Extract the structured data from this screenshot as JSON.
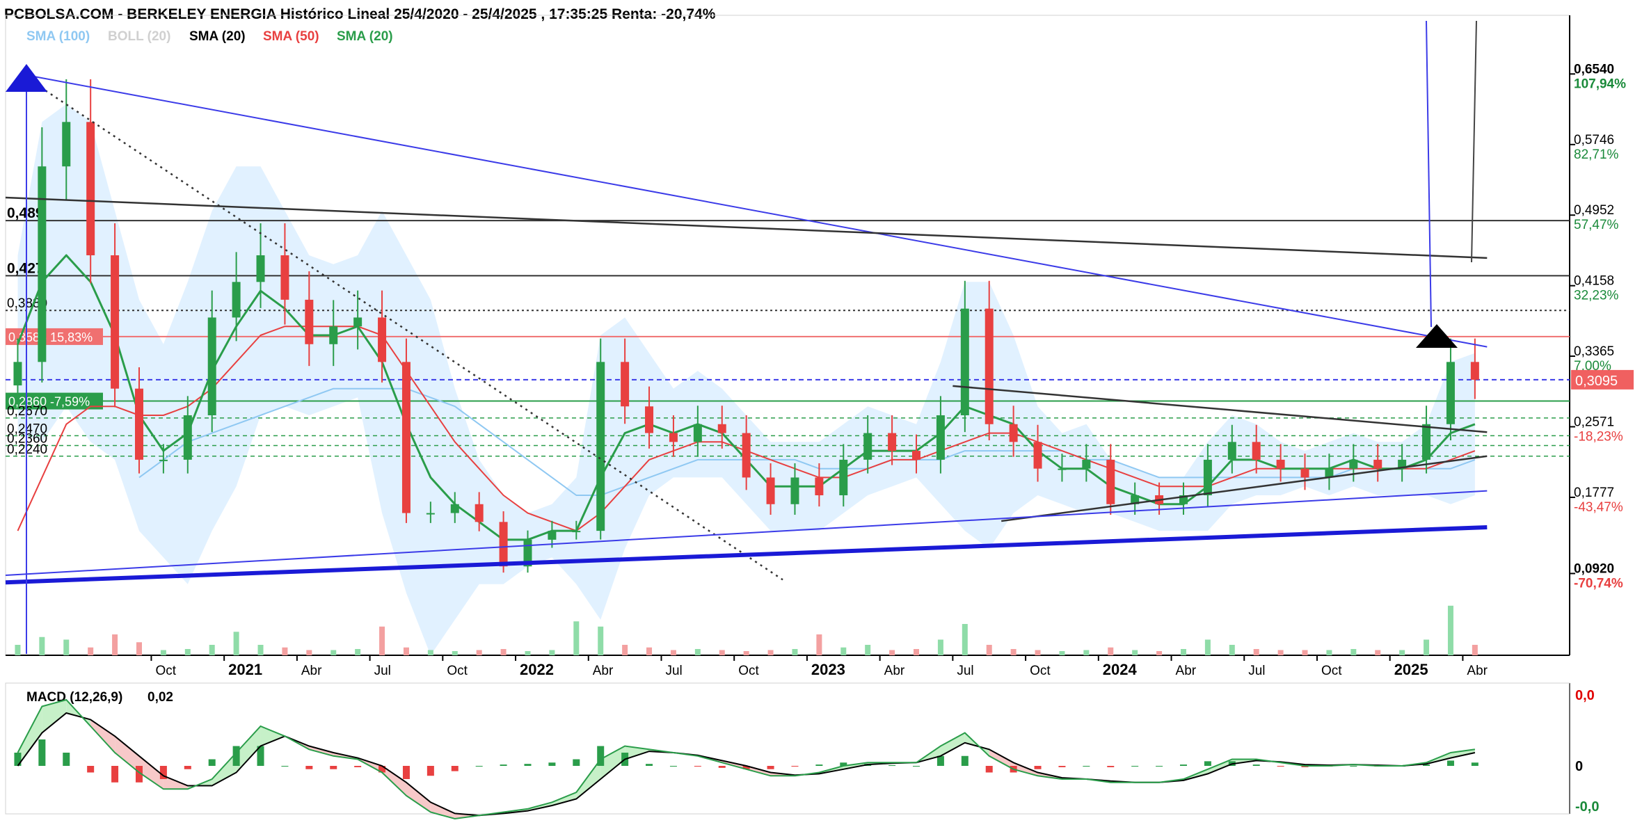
{
  "header": {
    "title": "PCBOLSA.COM - BERKELEY ENERGIA Histórico Lineal 25/4/2020 - 25/4/2025 , 17:35:25 Renta: -20,74%"
  },
  "legend": [
    {
      "label": "SMA (100)",
      "color": "#8fc8f2"
    },
    {
      "label": "BOLL (20)",
      "color": "#d0d0d0"
    },
    {
      "label": "SMA (20)",
      "color": "#000000"
    },
    {
      "label": "SMA (50)",
      "color": "#e84040"
    },
    {
      "label": "SMA (20)",
      "color": "#2a9d4a"
    }
  ],
  "colors": {
    "up": "#2a9d4a",
    "down": "#e84040",
    "trend_blue": "#3b3be8",
    "trend_black": "#333333",
    "boll_fill": "#dcefff",
    "sma100": "#8fc8f2"
  },
  "chart_data": {
    "type": "candlestick",
    "title": "PCBOLSA.COM - BERKELEY ENERGIA Histórico Lineal 25/4/2020 - 25/4/2025 , 17:35:25 Renta: -20,74%",
    "x_axis": {
      "ticks": [
        "Oct",
        "2021",
        "Abr",
        "Jul",
        "Oct",
        "2022",
        "Abr",
        "Jul",
        "Oct",
        "2023",
        "Abr",
        "Jul",
        "Oct",
        "2024",
        "Abr",
        "Jul",
        "Oct",
        "2025",
        "Abr"
      ],
      "bold_ticks": [
        "2021",
        "2022",
        "2023",
        "2024",
        "2025"
      ]
    },
    "y_axis": {
      "ticks": [
        {
          "price": "0,6540",
          "pct": "107,94%",
          "pct_color": "#1a8a3a"
        },
        {
          "price": "0,5746",
          "pct": "82,71%",
          "pct_color": "#1a8a3a"
        },
        {
          "price": "0,4952",
          "pct": "57,47%",
          "pct_color": "#1a8a3a"
        },
        {
          "price": "0,4158",
          "pct": "32,23%",
          "pct_color": "#1a8a3a"
        },
        {
          "price": "0,3365",
          "pct": "7,00%",
          "pct_color": "#1a8a3a"
        },
        {
          "price": "0,2571",
          "pct": "-18,23%",
          "pct_color": "#e84040"
        },
        {
          "price": "0,1777",
          "pct": "-43,47%",
          "pct_color": "#e84040"
        },
        {
          "price": "0,0920",
          "pct": "-70,74%",
          "pct_color": "#e84040"
        }
      ],
      "last_price": "0,3095",
      "range": [
        0.0,
        0.72
      ]
    },
    "levels": [
      {
        "value": 0.489,
        "label": "0,489"
      },
      {
        "value": 0.427,
        "label": "0,427"
      },
      {
        "value": 0.388,
        "label": "0,3880"
      },
      {
        "value": 0.3585,
        "label": "0,3585 15,83%"
      },
      {
        "value": 0.286,
        "label": "0,2860 -7,59%"
      },
      {
        "value": 0.267,
        "label": "0,2670"
      },
      {
        "value": 0.247,
        "label": "0,2470"
      },
      {
        "value": 0.236,
        "label": "0,2360"
      },
      {
        "value": 0.224,
        "label": "0,2240"
      }
    ],
    "price_series": [
      {
        "date": "2020-04",
        "value": 0.33
      },
      {
        "date": "2020-05",
        "value": 0.55
      },
      {
        "date": "2020-06",
        "value": 0.6
      },
      {
        "date": "2020-07",
        "value": 0.45
      },
      {
        "date": "2020-08",
        "value": 0.3
      },
      {
        "date": "2020-09",
        "value": 0.22
      },
      {
        "date": "2020-10",
        "value": 0.22
      },
      {
        "date": "2020-11",
        "value": 0.27
      },
      {
        "date": "2020-12",
        "value": 0.38
      },
      {
        "date": "2021-01",
        "value": 0.42
      },
      {
        "date": "2021-02",
        "value": 0.45
      },
      {
        "date": "2021-03",
        "value": 0.4
      },
      {
        "date": "2021-04",
        "value": 0.35
      },
      {
        "date": "2021-05",
        "value": 0.37
      },
      {
        "date": "2021-06",
        "value": 0.38
      },
      {
        "date": "2021-07",
        "value": 0.33
      },
      {
        "date": "2021-08",
        "value": 0.16
      },
      {
        "date": "2021-09",
        "value": 0.16
      },
      {
        "date": "2021-10",
        "value": 0.17
      },
      {
        "date": "2021-11",
        "value": 0.15
      },
      {
        "date": "2021-12",
        "value": 0.1
      },
      {
        "date": "2022-01",
        "value": 0.13
      },
      {
        "date": "2022-02",
        "value": 0.14
      },
      {
        "date": "2022-03",
        "value": 0.14
      },
      {
        "date": "2022-04",
        "value": 0.33
      },
      {
        "date": "2022-05",
        "value": 0.28
      },
      {
        "date": "2022-06",
        "value": 0.25
      },
      {
        "date": "2022-07",
        "value": 0.24
      },
      {
        "date": "2022-08",
        "value": 0.26
      },
      {
        "date": "2022-09",
        "value": 0.25
      },
      {
        "date": "2022-10",
        "value": 0.2
      },
      {
        "date": "2022-11",
        "value": 0.17
      },
      {
        "date": "2022-12",
        "value": 0.2
      },
      {
        "date": "2023-01",
        "value": 0.18
      },
      {
        "date": "2023-02",
        "value": 0.22
      },
      {
        "date": "2023-03",
        "value": 0.25
      },
      {
        "date": "2023-04",
        "value": 0.23
      },
      {
        "date": "2023-05",
        "value": 0.22
      },
      {
        "date": "2023-06",
        "value": 0.27
      },
      {
        "date": "2023-07",
        "value": 0.39
      },
      {
        "date": "2023-08",
        "value": 0.26
      },
      {
        "date": "2023-09",
        "value": 0.24
      },
      {
        "date": "2023-10",
        "value": 0.21
      },
      {
        "date": "2023-11",
        "value": 0.21
      },
      {
        "date": "2023-12",
        "value": 0.22
      },
      {
        "date": "2024-01",
        "value": 0.17
      },
      {
        "date": "2024-02",
        "value": 0.18
      },
      {
        "date": "2024-03",
        "value": 0.17
      },
      {
        "date": "2024-04",
        "value": 0.18
      },
      {
        "date": "2024-05",
        "value": 0.22
      },
      {
        "date": "2024-06",
        "value": 0.24
      },
      {
        "date": "2024-07",
        "value": 0.22
      },
      {
        "date": "2024-08",
        "value": 0.21
      },
      {
        "date": "2024-09",
        "value": 0.2
      },
      {
        "date": "2024-10",
        "value": 0.21
      },
      {
        "date": "2024-11",
        "value": 0.22
      },
      {
        "date": "2024-12",
        "value": 0.21
      },
      {
        "date": "2025-01",
        "value": 0.22
      },
      {
        "date": "2025-02",
        "value": 0.26
      },
      {
        "date": "2025-03",
        "value": 0.33
      },
      {
        "date": "2025-04",
        "value": 0.31
      }
    ],
    "sma20": [
      0.35,
      0.42,
      0.45,
      0.42,
      0.36,
      0.27,
      0.23,
      0.25,
      0.32,
      0.37,
      0.41,
      0.39,
      0.36,
      0.36,
      0.37,
      0.33,
      0.26,
      0.2,
      0.17,
      0.15,
      0.13,
      0.13,
      0.14,
      0.14,
      0.2,
      0.25,
      0.26,
      0.25,
      0.26,
      0.25,
      0.22,
      0.19,
      0.19,
      0.19,
      0.21,
      0.23,
      0.23,
      0.23,
      0.25,
      0.28,
      0.27,
      0.26,
      0.23,
      0.21,
      0.21,
      0.19,
      0.18,
      0.17,
      0.17,
      0.19,
      0.22,
      0.22,
      0.21,
      0.21,
      0.21,
      0.22,
      0.21,
      0.21,
      0.22,
      0.25,
      0.26
    ],
    "sma50": [
      0.14,
      0.2,
      0.26,
      0.28,
      0.28,
      0.27,
      0.27,
      0.28,
      0.3,
      0.33,
      0.36,
      0.37,
      0.37,
      0.37,
      0.37,
      0.36,
      0.32,
      0.28,
      0.24,
      0.21,
      0.18,
      0.16,
      0.15,
      0.14,
      0.16,
      0.19,
      0.22,
      0.23,
      0.24,
      0.24,
      0.23,
      0.22,
      0.21,
      0.2,
      0.2,
      0.21,
      0.22,
      0.22,
      0.23,
      0.24,
      0.25,
      0.25,
      0.24,
      0.23,
      0.22,
      0.21,
      0.2,
      0.19,
      0.19,
      0.19,
      0.2,
      0.21,
      0.21,
      0.21,
      0.21,
      0.21,
      0.21,
      0.21,
      0.21,
      0.22,
      0.23
    ],
    "sma100": [
      null,
      null,
      null,
      null,
      null,
      0.2,
      0.22,
      0.24,
      0.25,
      0.26,
      0.27,
      0.28,
      0.29,
      0.3,
      0.3,
      0.3,
      0.3,
      0.29,
      0.28,
      0.26,
      0.24,
      0.22,
      0.2,
      0.18,
      0.18,
      0.19,
      0.2,
      0.21,
      0.22,
      0.22,
      0.22,
      0.22,
      0.22,
      0.21,
      0.21,
      0.21,
      0.22,
      0.22,
      0.22,
      0.23,
      0.23,
      0.23,
      0.23,
      0.23,
      0.22,
      0.22,
      0.21,
      0.2,
      0.2,
      0.2,
      0.2,
      0.2,
      0.2,
      0.2,
      0.2,
      0.21,
      0.21,
      0.21,
      0.21,
      0.21,
      0.22
    ],
    "boll_upper": [
      0.45,
      0.6,
      0.62,
      0.6,
      0.5,
      0.4,
      0.35,
      0.42,
      0.5,
      0.55,
      0.55,
      0.5,
      0.45,
      0.44,
      0.45,
      0.5,
      0.45,
      0.4,
      0.3,
      0.22,
      0.18,
      0.16,
      0.17,
      0.2,
      0.36,
      0.38,
      0.34,
      0.3,
      0.32,
      0.3,
      0.27,
      0.24,
      0.24,
      0.24,
      0.26,
      0.28,
      0.27,
      0.26,
      0.33,
      0.42,
      0.42,
      0.36,
      0.28,
      0.25,
      0.26,
      0.22,
      0.21,
      0.2,
      0.2,
      0.24,
      0.27,
      0.26,
      0.24,
      0.23,
      0.24,
      0.25,
      0.24,
      0.24,
      0.26,
      0.33,
      0.34
    ],
    "boll_lower": [
      0.25,
      0.24,
      0.28,
      0.24,
      0.22,
      0.14,
      0.11,
      0.08,
      0.14,
      0.19,
      0.27,
      0.28,
      0.27,
      0.28,
      0.29,
      0.16,
      0.07,
      0.0,
      0.04,
      0.08,
      0.08,
      0.1,
      0.11,
      0.08,
      0.04,
      0.12,
      0.18,
      0.2,
      0.2,
      0.2,
      0.17,
      0.14,
      0.14,
      0.14,
      0.16,
      0.18,
      0.19,
      0.2,
      0.17,
      0.14,
      0.12,
      0.16,
      0.18,
      0.17,
      0.16,
      0.16,
      0.15,
      0.14,
      0.14,
      0.14,
      0.17,
      0.18,
      0.18,
      0.19,
      0.18,
      0.19,
      0.18,
      0.18,
      0.18,
      0.17,
      0.18
    ],
    "volume": [
      0.2,
      0.35,
      0.3,
      0.15,
      0.4,
      0.25,
      0.1,
      0.12,
      0.2,
      0.45,
      0.2,
      0.15,
      0.1,
      0.1,
      0.12,
      0.55,
      0.15,
      0.1,
      0.08,
      0.1,
      0.12,
      0.08,
      0.1,
      0.65,
      0.55,
      0.2,
      0.15,
      0.1,
      0.12,
      0.1,
      0.08,
      0.1,
      0.12,
      0.4,
      0.15,
      0.2,
      0.1,
      0.12,
      0.3,
      0.6,
      0.2,
      0.12,
      0.1,
      0.08,
      0.1,
      0.15,
      0.1,
      0.08,
      0.12,
      0.3,
      0.2,
      0.12,
      0.1,
      0.1,
      0.1,
      0.12,
      0.1,
      0.1,
      0.3,
      0.95,
      0.2
    ],
    "trendlines": [
      {
        "points": [
          [
            "2020-05",
            0.652
          ],
          [
            "2025-05",
            0.347
          ]
        ],
        "color": "#3b3be8",
        "width": 2
      },
      {
        "points": [
          [
            "2020-04",
            0.515
          ],
          [
            "2025-05",
            0.447
          ]
        ],
        "color": "#333333",
        "width": 2.5
      },
      {
        "points": [
          [
            "2020-05",
            0.647
          ],
          [
            "2022-12",
            0.085
          ]
        ],
        "color": "#333333",
        "width": 2.5,
        "dotted": true
      },
      {
        "points": [
          [
            "2023-07",
            0.303
          ],
          [
            "2025-05",
            0.251
          ]
        ],
        "color": "#333333",
        "width": 2.5
      },
      {
        "points": [
          [
            "2023-09",
            0.151
          ],
          [
            "2025-05",
            0.224
          ]
        ],
        "color": "#333333",
        "width": 2.5
      },
      {
        "points": [
          [
            "2020-04",
            0.09
          ],
          [
            "2025-05",
            0.185
          ]
        ],
        "color": "#3b3be8",
        "width": 2
      },
      {
        "points": [
          [
            "2020-04",
            0.082
          ],
          [
            "2025-05",
            0.144
          ]
        ],
        "color": "#1a1ad6",
        "width": 6
      }
    ],
    "macd": {
      "label": "MACD (12,26,9)",
      "value": "0,02",
      "y_ticks": [
        {
          "label": "0,0",
          "color": "#e00000"
        },
        {
          "label": "0",
          "color": "#000000"
        },
        {
          "label": "-0,0",
          "color": "#1a8a3a"
        }
      ],
      "macd_line": [
        0.2,
        0.9,
        1.0,
        0.6,
        0.2,
        -0.1,
        -0.35,
        -0.35,
        -0.2,
        0.2,
        0.6,
        0.45,
        0.25,
        0.15,
        0.1,
        -0.1,
        -0.45,
        -0.7,
        -0.8,
        -0.75,
        -0.7,
        -0.65,
        -0.55,
        -0.4,
        0.1,
        0.3,
        0.25,
        0.2,
        0.15,
        0.05,
        -0.05,
        -0.15,
        -0.15,
        -0.1,
        0.0,
        0.05,
        0.05,
        0.05,
        0.3,
        0.5,
        0.15,
        -0.05,
        -0.15,
        -0.2,
        -0.2,
        -0.25,
        -0.25,
        -0.25,
        -0.2,
        -0.05,
        0.1,
        0.1,
        0.05,
        0.0,
        0.0,
        0.02,
        0.0,
        0.0,
        0.05,
        0.2,
        0.25
      ],
      "signal_line": [
        0.0,
        0.5,
        0.8,
        0.7,
        0.45,
        0.15,
        -0.15,
        -0.3,
        -0.3,
        -0.1,
        0.3,
        0.45,
        0.3,
        0.2,
        0.12,
        0.0,
        -0.25,
        -0.55,
        -0.72,
        -0.75,
        -0.72,
        -0.68,
        -0.6,
        -0.5,
        -0.2,
        0.1,
        0.22,
        0.2,
        0.16,
        0.08,
        0.0,
        -0.1,
        -0.14,
        -0.12,
        -0.05,
        0.02,
        0.04,
        0.05,
        0.15,
        0.35,
        0.25,
        0.05,
        -0.1,
        -0.18,
        -0.2,
        -0.23,
        -0.25,
        -0.25,
        -0.22,
        -0.12,
        0.03,
        0.08,
        0.06,
        0.02,
        0.01,
        0.02,
        0.01,
        0.0,
        0.03,
        0.12,
        0.2
      ],
      "histogram": [
        0.2,
        0.4,
        0.2,
        -0.1,
        -0.25,
        -0.25,
        -0.2,
        -0.05,
        0.1,
        0.3,
        0.3,
        0.0,
        -0.05,
        -0.05,
        -0.02,
        -0.1,
        -0.2,
        -0.15,
        -0.08,
        0.0,
        0.02,
        0.03,
        0.05,
        0.1,
        0.3,
        0.2,
        0.03,
        0.0,
        -0.01,
        -0.03,
        -0.05,
        -0.05,
        -0.01,
        0.02,
        0.05,
        0.03,
        0.01,
        0.0,
        0.15,
        0.15,
        -0.1,
        -0.1,
        -0.05,
        -0.02,
        0.0,
        -0.02,
        0.0,
        0.0,
        0.02,
        0.07,
        0.07,
        0.02,
        -0.01,
        -0.02,
        -0.01,
        0.0,
        -0.01,
        0.0,
        0.02,
        0.08,
        0.05
      ]
    }
  }
}
